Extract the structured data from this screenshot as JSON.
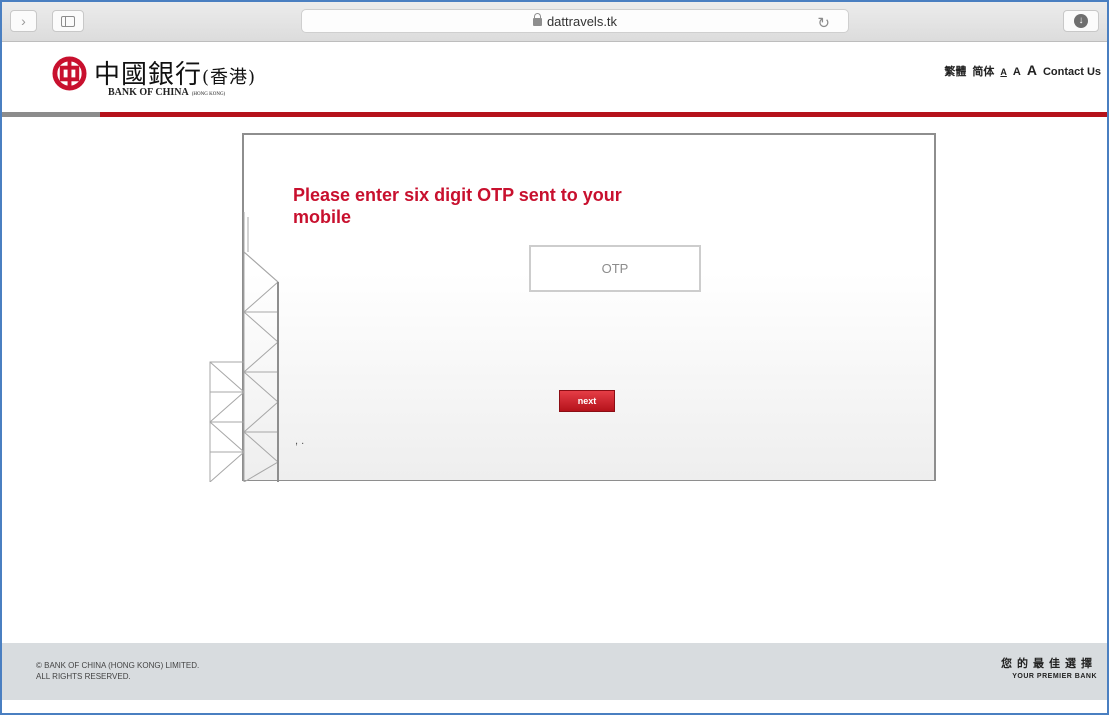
{
  "browser": {
    "url": "dattravels.tk",
    "icons": {
      "back": "chevron-right-icon",
      "sidebar": "sidebar-icon",
      "lock": "lock-icon",
      "reload": "reload-icon",
      "download": "download-icon"
    }
  },
  "header": {
    "logo_cn": "中國銀行",
    "logo_cn_suffix": "(香港)",
    "logo_en": "BANK OF CHINA",
    "logo_en_suffix": "(HONG KONG)",
    "nav": {
      "traditional": "繁體",
      "simplified": "简体",
      "font_small": "A",
      "font_medium": "A",
      "font_large": "A",
      "contact": "Contact Us"
    }
  },
  "main": {
    "heading": "Please enter six digit OTP sent to your mobile",
    "otp_placeholder": "OTP",
    "otp_value": "",
    "next_label": "next",
    "dots": ", ."
  },
  "footer": {
    "copyright_line1": "© BANK OF CHINA (HONG KONG) LIMITED.",
    "copyright_line2": "ALL RIGHTS RESERVED.",
    "slogan_cn": "您的最佳選擇",
    "slogan_en": "YOUR PREMIER BANK"
  },
  "colors": {
    "brand_red": "#c8102e",
    "header_line": "#b5121b",
    "footer_bg": "#d8dcdf"
  }
}
